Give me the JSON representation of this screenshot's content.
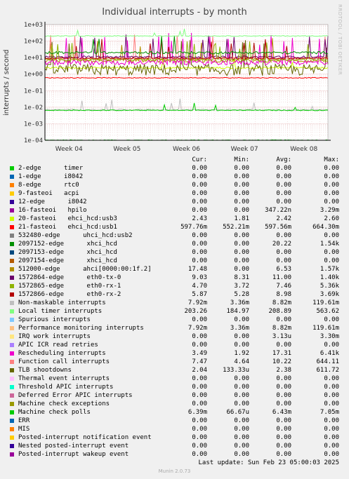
{
  "title": "Individual interrupts - by month",
  "watermark": "RRDTOOL / TOBI OETIKER",
  "footer": {
    "last_update": "Last update: Sun Feb 23 05:00:03 2025",
    "munin": "Munin 2.0.73"
  },
  "chart_data": {
    "type": "line",
    "title": "Individual interrupts - by month",
    "ylabel": "interrupts / second",
    "yscale": "log",
    "ylim": [
      0.0001,
      1000
    ],
    "yticks": [
      "1e-04",
      "1e-03",
      "1e-02",
      "1e-01",
      "1e+00",
      "1e+01",
      "1e+02",
      "1e+03"
    ],
    "xticks": [
      "Week 04",
      "Week 05",
      "Week 06",
      "Week 07",
      "Week 08"
    ],
    "grid": true,
    "columns": [
      "Cur:",
      "Min:",
      "Avg:",
      "Max:"
    ],
    "series": [
      {
        "name": "2-edge      timer",
        "color": "#00cc00",
        "cur": "0.00",
        "min": "0.00",
        "avg": "0.00",
        "max": "0.00"
      },
      {
        "name": "1-edge      i8042",
        "color": "#0066b3",
        "cur": "0.00",
        "min": "0.00",
        "avg": "0.00",
        "max": "0.00"
      },
      {
        "name": "8-edge      rtc0",
        "color": "#ff8000",
        "cur": "0.00",
        "min": "0.00",
        "avg": "0.00",
        "max": "0.00"
      },
      {
        "name": "9-fasteoi   acpi",
        "color": "#ffcc00",
        "cur": "0.00",
        "min": "0.00",
        "avg": "0.00",
        "max": "0.00"
      },
      {
        "name": "12-edge      i8042",
        "color": "#330099",
        "cur": "0.00",
        "min": "0.00",
        "avg": "0.00",
        "max": "0.00"
      },
      {
        "name": "16-fasteoi   hpilo",
        "color": "#990099",
        "cur": "0.00",
        "min": "0.00",
        "avg": "347.22n",
        "max": "3.29m"
      },
      {
        "name": "20-fasteoi   ehci_hcd:usb3",
        "color": "#ccff00",
        "cur": "2.43",
        "min": "1.81",
        "avg": "2.42",
        "max": "2.60"
      },
      {
        "name": "21-fasteoi   ehci_hcd:usb1",
        "color": "#ff0000",
        "cur": "597.76m",
        "min": "552.21m",
        "avg": "597.56m",
        "max": "664.30m"
      },
      {
        "name": "532480-edge      uhci_hcd:usb2",
        "color": "#808080",
        "cur": "0.00",
        "min": "0.00",
        "avg": "0.00",
        "max": "0.00"
      },
      {
        "name": "2097152-edge      xhci_hcd",
        "color": "#008f00",
        "cur": "0.00",
        "min": "0.00",
        "avg": "20.22",
        "max": "1.54k"
      },
      {
        "name": "2097153-edge      xhci_hcd",
        "color": "#00487d",
        "cur": "0.00",
        "min": "0.00",
        "avg": "0.00",
        "max": "0.00"
      },
      {
        "name": "2097154-edge      xhci_hcd",
        "color": "#b35a00",
        "cur": "0.00",
        "min": "0.00",
        "avg": "0.00",
        "max": "0.00"
      },
      {
        "name": "512000-edge      ahci[0000:00:1f.2]",
        "color": "#b38f00",
        "cur": "17.48",
        "min": "0.00",
        "avg": "6.53",
        "max": "1.57k"
      },
      {
        "name": "1572864-edge      eth0-tx-0",
        "color": "#6b006b",
        "cur": "9.03",
        "min": "8.31",
        "avg": "11.00",
        "max": "1.40k"
      },
      {
        "name": "1572865-edge      eth0-rx-1",
        "color": "#8fb300",
        "cur": "4.70",
        "min": "3.72",
        "avg": "7.46",
        "max": "5.36k"
      },
      {
        "name": "1572866-edge      eth0-rx-2",
        "color": "#b30000",
        "cur": "5.87",
        "min": "5.28",
        "avg": "8.98",
        "max": "3.69k"
      },
      {
        "name": "Non-maskable interrupts",
        "color": "#bebebe",
        "cur": "7.92m",
        "min": "3.36m",
        "avg": "8.82m",
        "max": "119.61m"
      },
      {
        "name": "Local timer interrupts",
        "color": "#80ff80",
        "cur": "203.26",
        "min": "184.97",
        "avg": "208.89",
        "max": "563.62"
      },
      {
        "name": "Spurious interrupts",
        "color": "#80c9ff",
        "cur": "0.00",
        "min": "0.00",
        "avg": "0.00",
        "max": "0.00"
      },
      {
        "name": "Performance monitoring interrupts",
        "color": "#ffc080",
        "cur": "7.92m",
        "min": "3.36m",
        "avg": "8.82m",
        "max": "119.61m"
      },
      {
        "name": "IRQ work interrupts",
        "color": "#ffe680",
        "cur": "0.00",
        "min": "0.00",
        "avg": "3.13u",
        "max": "3.30m"
      },
      {
        "name": "APIC ICR read retries",
        "color": "#aa80ff",
        "cur": "0.00",
        "min": "0.00",
        "avg": "0.00",
        "max": "0.00"
      },
      {
        "name": "Rescheduling interrupts",
        "color": "#ee00cc",
        "cur": "3.49",
        "min": "1.92",
        "avg": "17.31",
        "max": "6.41k"
      },
      {
        "name": "Function call interrupts",
        "color": "#ff8080",
        "cur": "7.47",
        "min": "4.64",
        "avg": "10.22",
        "max": "644.11"
      },
      {
        "name": "TLB shootdowns",
        "color": "#666600",
        "cur": "2.04",
        "min": "133.33u",
        "avg": "2.38",
        "max": "611.72"
      },
      {
        "name": "Thermal event interrupts",
        "color": "#ffbfff",
        "cur": "0.00",
        "min": "0.00",
        "avg": "0.00",
        "max": "0.00"
      },
      {
        "name": "Threshold APIC interrupts",
        "color": "#00ffcc",
        "cur": "0.00",
        "min": "0.00",
        "avg": "0.00",
        "max": "0.00"
      },
      {
        "name": "Deferred Error APIC interrupts",
        "color": "#cc6699",
        "cur": "0.00",
        "min": "0.00",
        "avg": "0.00",
        "max": "0.00"
      },
      {
        "name": "Machine check exceptions",
        "color": "#999900",
        "cur": "0.00",
        "min": "0.00",
        "avg": "0.00",
        "max": "0.00"
      },
      {
        "name": "Machine check polls",
        "color": "#00cc00",
        "cur": "6.39m",
        "min": "66.67u",
        "avg": "6.43m",
        "max": "7.05m"
      },
      {
        "name": "ERR",
        "color": "#0066b3",
        "cur": "0.00",
        "min": "0.00",
        "avg": "0.00",
        "max": "0.00"
      },
      {
        "name": "MIS",
        "color": "#ff8000",
        "cur": "0.00",
        "min": "0.00",
        "avg": "0.00",
        "max": "0.00"
      },
      {
        "name": "Posted-interrupt notification event",
        "color": "#ffcc00",
        "cur": "0.00",
        "min": "0.00",
        "avg": "0.00",
        "max": "0.00"
      },
      {
        "name": "Nested posted-interrupt event",
        "color": "#330099",
        "cur": "0.00",
        "min": "0.00",
        "avg": "0.00",
        "max": "0.00"
      },
      {
        "name": "Posted-interrupt wakeup event",
        "color": "#990099",
        "cur": "0.00",
        "min": "0.00",
        "avg": "0.00",
        "max": "0.00"
      }
    ]
  }
}
